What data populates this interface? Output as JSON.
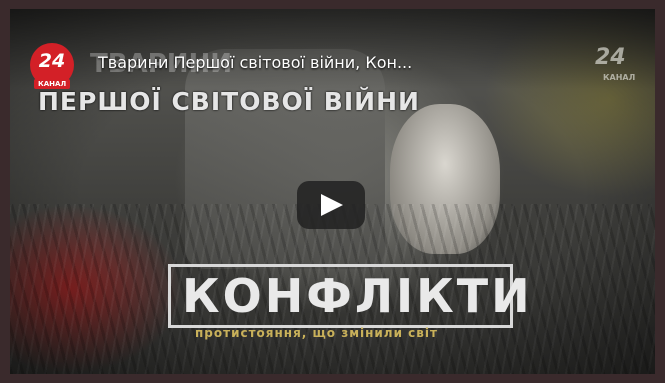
{
  "video": {
    "title": "Тварини Першої світової війни, Кон...",
    "overlay_subtitle": "ПЕРШОЇ СВІТОВОЇ ВІЙНИ",
    "overlay_ghost": "ТВАРИНИ",
    "show_name": "КОНФЛІКТИ",
    "show_tagline": "протистояння, що змінили світ"
  },
  "channel": {
    "logo_number": "24",
    "logo_label": "КАНАЛ",
    "brand_color": "#d32027"
  },
  "controls": {
    "play_icon": "play-icon"
  }
}
